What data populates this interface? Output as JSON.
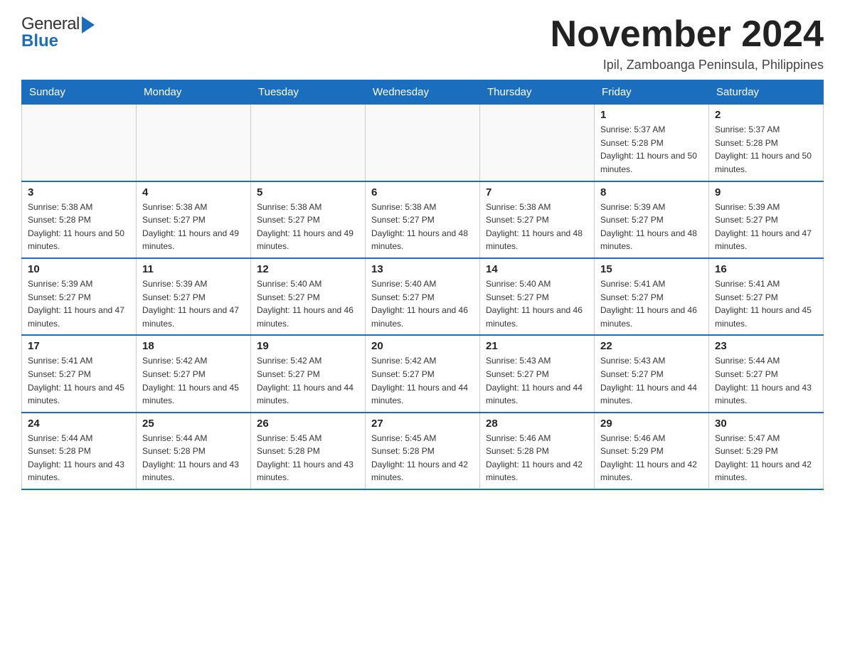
{
  "header": {
    "logo": {
      "general": "General",
      "blue": "Blue"
    },
    "title": "November 2024",
    "location": "Ipil, Zamboanga Peninsula, Philippines"
  },
  "calendar": {
    "days_of_week": [
      "Sunday",
      "Monday",
      "Tuesday",
      "Wednesday",
      "Thursday",
      "Friday",
      "Saturday"
    ],
    "weeks": [
      [
        {
          "day": "",
          "info": ""
        },
        {
          "day": "",
          "info": ""
        },
        {
          "day": "",
          "info": ""
        },
        {
          "day": "",
          "info": ""
        },
        {
          "day": "",
          "info": ""
        },
        {
          "day": "1",
          "info": "Sunrise: 5:37 AM\nSunset: 5:28 PM\nDaylight: 11 hours and 50 minutes."
        },
        {
          "day": "2",
          "info": "Sunrise: 5:37 AM\nSunset: 5:28 PM\nDaylight: 11 hours and 50 minutes."
        }
      ],
      [
        {
          "day": "3",
          "info": "Sunrise: 5:38 AM\nSunset: 5:28 PM\nDaylight: 11 hours and 50 minutes."
        },
        {
          "day": "4",
          "info": "Sunrise: 5:38 AM\nSunset: 5:27 PM\nDaylight: 11 hours and 49 minutes."
        },
        {
          "day": "5",
          "info": "Sunrise: 5:38 AM\nSunset: 5:27 PM\nDaylight: 11 hours and 49 minutes."
        },
        {
          "day": "6",
          "info": "Sunrise: 5:38 AM\nSunset: 5:27 PM\nDaylight: 11 hours and 48 minutes."
        },
        {
          "day": "7",
          "info": "Sunrise: 5:38 AM\nSunset: 5:27 PM\nDaylight: 11 hours and 48 minutes."
        },
        {
          "day": "8",
          "info": "Sunrise: 5:39 AM\nSunset: 5:27 PM\nDaylight: 11 hours and 48 minutes."
        },
        {
          "day": "9",
          "info": "Sunrise: 5:39 AM\nSunset: 5:27 PM\nDaylight: 11 hours and 47 minutes."
        }
      ],
      [
        {
          "day": "10",
          "info": "Sunrise: 5:39 AM\nSunset: 5:27 PM\nDaylight: 11 hours and 47 minutes."
        },
        {
          "day": "11",
          "info": "Sunrise: 5:39 AM\nSunset: 5:27 PM\nDaylight: 11 hours and 47 minutes."
        },
        {
          "day": "12",
          "info": "Sunrise: 5:40 AM\nSunset: 5:27 PM\nDaylight: 11 hours and 46 minutes."
        },
        {
          "day": "13",
          "info": "Sunrise: 5:40 AM\nSunset: 5:27 PM\nDaylight: 11 hours and 46 minutes."
        },
        {
          "day": "14",
          "info": "Sunrise: 5:40 AM\nSunset: 5:27 PM\nDaylight: 11 hours and 46 minutes."
        },
        {
          "day": "15",
          "info": "Sunrise: 5:41 AM\nSunset: 5:27 PM\nDaylight: 11 hours and 46 minutes."
        },
        {
          "day": "16",
          "info": "Sunrise: 5:41 AM\nSunset: 5:27 PM\nDaylight: 11 hours and 45 minutes."
        }
      ],
      [
        {
          "day": "17",
          "info": "Sunrise: 5:41 AM\nSunset: 5:27 PM\nDaylight: 11 hours and 45 minutes."
        },
        {
          "day": "18",
          "info": "Sunrise: 5:42 AM\nSunset: 5:27 PM\nDaylight: 11 hours and 45 minutes."
        },
        {
          "day": "19",
          "info": "Sunrise: 5:42 AM\nSunset: 5:27 PM\nDaylight: 11 hours and 44 minutes."
        },
        {
          "day": "20",
          "info": "Sunrise: 5:42 AM\nSunset: 5:27 PM\nDaylight: 11 hours and 44 minutes."
        },
        {
          "day": "21",
          "info": "Sunrise: 5:43 AM\nSunset: 5:27 PM\nDaylight: 11 hours and 44 minutes."
        },
        {
          "day": "22",
          "info": "Sunrise: 5:43 AM\nSunset: 5:27 PM\nDaylight: 11 hours and 44 minutes."
        },
        {
          "day": "23",
          "info": "Sunrise: 5:44 AM\nSunset: 5:27 PM\nDaylight: 11 hours and 43 minutes."
        }
      ],
      [
        {
          "day": "24",
          "info": "Sunrise: 5:44 AM\nSunset: 5:28 PM\nDaylight: 11 hours and 43 minutes."
        },
        {
          "day": "25",
          "info": "Sunrise: 5:44 AM\nSunset: 5:28 PM\nDaylight: 11 hours and 43 minutes."
        },
        {
          "day": "26",
          "info": "Sunrise: 5:45 AM\nSunset: 5:28 PM\nDaylight: 11 hours and 43 minutes."
        },
        {
          "day": "27",
          "info": "Sunrise: 5:45 AM\nSunset: 5:28 PM\nDaylight: 11 hours and 42 minutes."
        },
        {
          "day": "28",
          "info": "Sunrise: 5:46 AM\nSunset: 5:28 PM\nDaylight: 11 hours and 42 minutes."
        },
        {
          "day": "29",
          "info": "Sunrise: 5:46 AM\nSunset: 5:29 PM\nDaylight: 11 hours and 42 minutes."
        },
        {
          "day": "30",
          "info": "Sunrise: 5:47 AM\nSunset: 5:29 PM\nDaylight: 11 hours and 42 minutes."
        }
      ]
    ]
  }
}
